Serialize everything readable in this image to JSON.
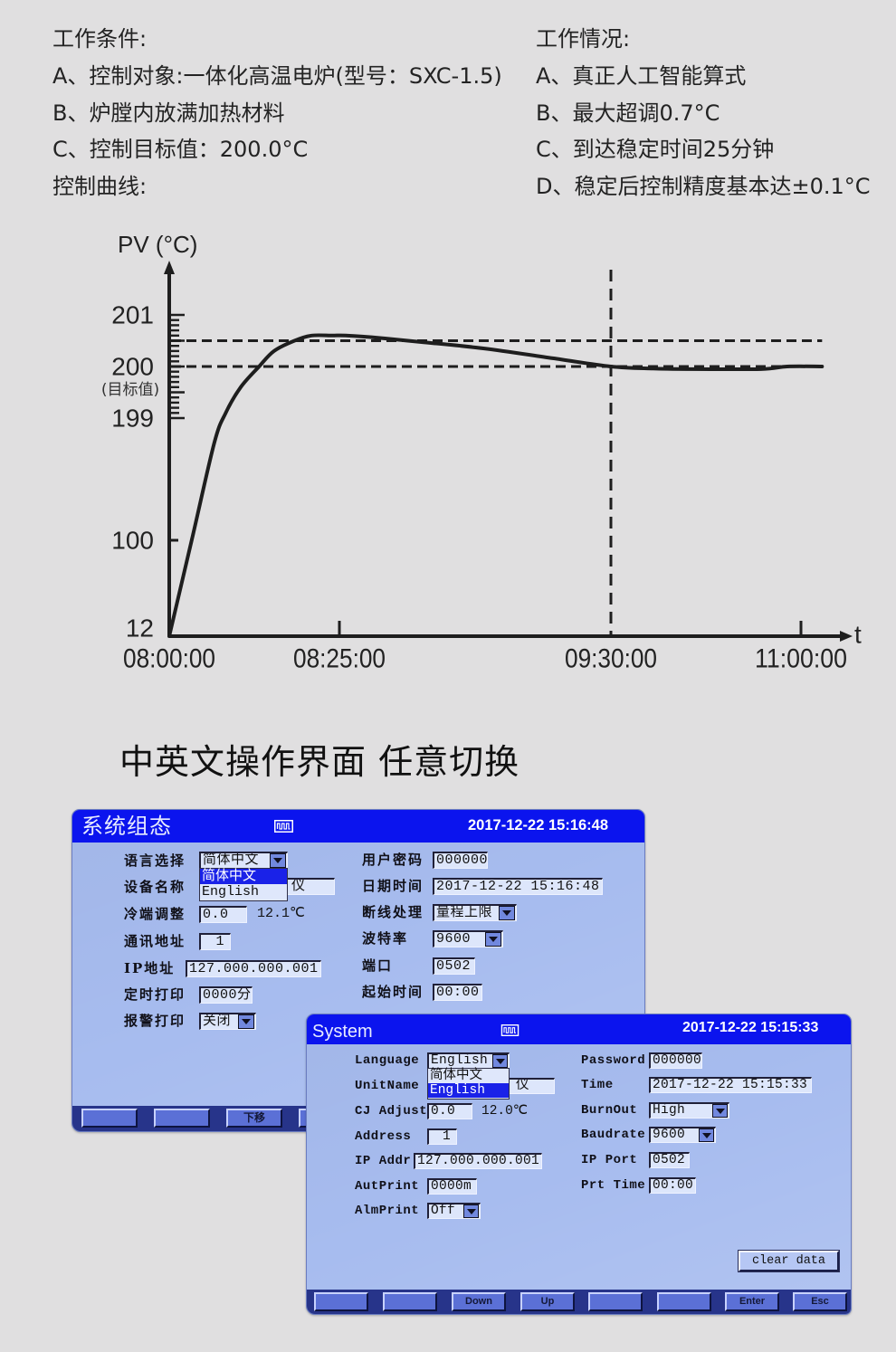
{
  "colors": {
    "page_background": "#e0dfe0",
    "screen_title_bar": "#0b14ee",
    "screen_body": "#a7bcef",
    "softkey_bar": "#27348a",
    "selection_highlight": "#1a22e8",
    "chart_ink": "#1e1e1e"
  },
  "intro": {
    "conditions_heading": "工作条件:",
    "conditions": [
      "A、控制对象:一体化高温电炉(型号：SXC-1.5)",
      "B、炉膛内放满加热材料",
      "C、控制目标值：200.0°C"
    ],
    "curve_heading": "控制曲线:",
    "performance_heading": "工作情况:",
    "performance": [
      "A、真正人工智能算式",
      "B、最大超调0.7°C",
      "C、到达稳定时间25分钟",
      "D、稳定后控制精度基本达±0.1°C"
    ]
  },
  "chart_data": {
    "type": "line",
    "title": "",
    "ylabel": "PV (°C)",
    "xlabel": "t",
    "x_unit": "minutes after 08:00:00",
    "xlim": [
      0,
      190
    ],
    "ylim": [
      12,
      201
    ],
    "grid": false,
    "legend": "none",
    "x_ticks": [
      {
        "value": 0,
        "label": "08:00:00"
      },
      {
        "value": 25,
        "label": "08:25:00"
      },
      {
        "value": 90,
        "label": "09:30:00"
      },
      {
        "value": 180,
        "label": "11:00:00"
      }
    ],
    "y_ticks": [
      {
        "value": 201,
        "label": "201"
      },
      {
        "value": 200,
        "label": "200",
        "sublabel": "(目标值)"
      },
      {
        "value": 199,
        "label": "199"
      },
      {
        "value": 100,
        "label": "100"
      },
      {
        "value": 12,
        "label": "12"
      }
    ],
    "y_minor_ticks": {
      "from": 199,
      "to": 201,
      "step": 0.1,
      "major_every": 0.5
    },
    "reference_lines": [
      {
        "axis": "y",
        "value": 200.5,
        "style": "dashed"
      },
      {
        "axis": "y",
        "value": 200,
        "style": "dashed"
      },
      {
        "axis": "x",
        "value": 90,
        "style": "dashed"
      }
    ],
    "series": [
      {
        "name": "PV",
        "x": [
          0,
          3.3,
          6.6,
          8.3,
          10.5,
          13.2,
          15.4,
          18.4,
          20.9,
          24.0,
          26.5,
          35.0,
          45.2,
          59.7,
          76.1,
          90.0,
          110.0,
          128.0,
          161.0,
          173.5,
          190.0
        ],
        "y": [
          12,
          100,
          178.5,
          199.1,
          199.6,
          200.0,
          200.3,
          200.5,
          200.6,
          200.6,
          200.6,
          200.55,
          200.47,
          200.35,
          200.16,
          200.0,
          199.96,
          199.95,
          199.95,
          200.0,
          200.0
        ]
      }
    ]
  },
  "section_title": "中英文操作界面 任意切换",
  "screen_cn": {
    "title": "系统组态",
    "title_icon": "square-wave-icon",
    "datetime": "2017-12-22 15:16:48",
    "language": {
      "label": "语言选择",
      "value": "简体中文",
      "options": [
        "简体中文",
        "English"
      ],
      "highlighted_index": 0
    },
    "unit_name": {
      "label": "设备名称",
      "value_visible": "仪"
    },
    "cj_adjust": {
      "label": "冷端调整",
      "value": "0.0",
      "reading": "12.1℃"
    },
    "address": {
      "label": "通讯地址",
      "value": "1"
    },
    "ip_addr": {
      "label": "IP地址",
      "value": "127.000.000.001"
    },
    "auto_print": {
      "label": "定时打印",
      "value": "0000分"
    },
    "alarm_print": {
      "label": "报警打印",
      "value": "关闭"
    },
    "password": {
      "label": "用户密码",
      "value": "000000"
    },
    "time": {
      "label": "日期时间",
      "value": "2017-12-22 15:16:48"
    },
    "burnout": {
      "label": "断线处理",
      "value": "量程上限"
    },
    "baudrate": {
      "label": "波特率",
      "value": "9600"
    },
    "ip_port": {
      "label": "端口",
      "value": "0502"
    },
    "print_time": {
      "label": "起始时间",
      "value": "00:00"
    },
    "softkeys": [
      "",
      "",
      "下移",
      ""
    ]
  },
  "screen_en": {
    "title": "System",
    "title_icon": "square-wave-icon",
    "datetime": "2017-12-22 15:15:33",
    "language": {
      "label": "Language",
      "value": "English",
      "options": [
        "简体中文",
        "English"
      ],
      "highlighted_index": 1
    },
    "unit_name": {
      "label": "UnitName",
      "value_visible": "仪"
    },
    "cj_adjust": {
      "label": "CJ Adjust",
      "value": "0.0",
      "reading": "12.0℃"
    },
    "address": {
      "label": "Address",
      "value": "1"
    },
    "ip_addr": {
      "label": "IP Addr",
      "value": "127.000.000.001"
    },
    "auto_print": {
      "label": "AutPrint",
      "value": "0000m"
    },
    "alarm_print": {
      "label": "AlmPrint",
      "value": "Off"
    },
    "password": {
      "label": "Password",
      "value": "000000"
    },
    "time": {
      "label": "Time",
      "value": "2017-12-22 15:15:33"
    },
    "burnout": {
      "label": "BurnOut",
      "value": "High"
    },
    "baudrate": {
      "label": "Baudrate",
      "value": "9600"
    },
    "ip_port": {
      "label": "IP Port",
      "value": "0502"
    },
    "print_time": {
      "label": "Prt Time",
      "value": "00:00"
    },
    "clear_button": "clear data",
    "softkeys": [
      "",
      "",
      "Down",
      "Up",
      "",
      "",
      "Enter",
      "Esc"
    ]
  }
}
